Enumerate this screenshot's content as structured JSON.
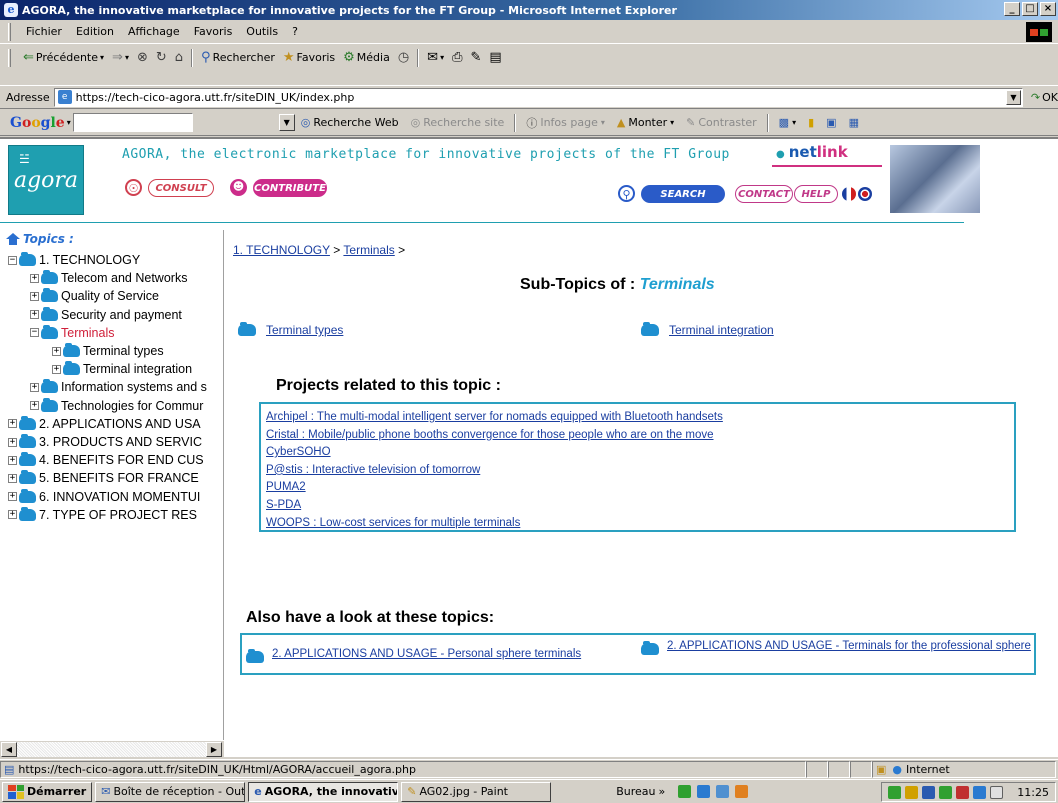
{
  "window": {
    "title": "AGORA, the innovative marketplace for innovative projects for the FT Group - Microsoft Internet Explorer",
    "controls": [
      "_",
      "□",
      "×"
    ]
  },
  "menu": [
    "Fichier",
    "Edition",
    "Affichage",
    "Favoris",
    "Outils",
    "?"
  ],
  "toolbar": {
    "back": "Précédente",
    "search": "Rechercher",
    "favorites": "Favoris",
    "media": "Média"
  },
  "address": {
    "label": "Adresse",
    "url": "https://tech-cico-agora.utt.fr/siteDIN_UK/index.php",
    "go": "OK"
  },
  "google_bar": {
    "logo": [
      "G",
      "o",
      "o",
      "g",
      "l",
      "e"
    ],
    "web_search": "Recherche Web",
    "site_search": "Recherche site",
    "page_info": "Infos page",
    "up": "Monter",
    "contrast": "Contraster"
  },
  "banner": {
    "logo_text": "agora",
    "tagline": "AGORA, the electronic marketplace for innovative projects of the FT Group",
    "consult": "CONSULT",
    "contribute": "CONTRIBUTE",
    "search": "SEARCH",
    "contact": "CONTACT",
    "help": "HELP",
    "netlink_net": "net",
    "netlink_link": "link"
  },
  "tree": {
    "title": "Topics :",
    "items": [
      {
        "label": "1. TECHNOLOGY",
        "level": 0,
        "expanded": true
      },
      {
        "label": "Telecom and Networks",
        "level": 1,
        "expanded": false
      },
      {
        "label": "Quality of Service",
        "level": 1,
        "expanded": false
      },
      {
        "label": "Security and payment",
        "level": 1,
        "expanded": false
      },
      {
        "label": "Terminals",
        "level": 1,
        "expanded": true,
        "active": true
      },
      {
        "label": "Terminal types",
        "level": 2,
        "expanded": false
      },
      {
        "label": "Terminal integration",
        "level": 2,
        "expanded": false
      },
      {
        "label": "Information systems and s",
        "level": 1,
        "expanded": false
      },
      {
        "label": "Technologies for Commur",
        "level": 1,
        "expanded": false
      },
      {
        "label": "2. APPLICATIONS AND USA",
        "level": 0,
        "expanded": false
      },
      {
        "label": "3. PRODUCTS AND SERVIC",
        "level": 0,
        "expanded": false
      },
      {
        "label": "4. BENEFITS FOR END CUS",
        "level": 0,
        "expanded": false
      },
      {
        "label": "5. BENEFITS FOR FRANCE",
        "level": 0,
        "expanded": false
      },
      {
        "label": "6. INNOVATION MOMENTUI",
        "level": 0,
        "expanded": false
      },
      {
        "label": "7. TYPE OF PROJECT RES",
        "level": 0,
        "expanded": false
      }
    ]
  },
  "breadcrumb": {
    "part1": "1. TECHNOLOGY",
    "sep": ">",
    "part2": "Terminals"
  },
  "main": {
    "subtopics_label": "Sub-Topics of : ",
    "subtopics_topic": "Terminals",
    "subtopics": [
      "Terminal types",
      "Terminal integration"
    ],
    "projects_title": "Projects related to this topic :",
    "projects": [
      "Archipel : The multi-modal intelligent server for nomads equipped with Bluetooth handsets",
      "Cristal : Mobile/public phone booths convergence for those people who are on the move",
      "CyberSOHO",
      "P@stis : Interactive television of tomorrow",
      "PUMA2",
      "S-PDA",
      "WOOPS : Low-cost services for multiple terminals"
    ],
    "related_title": "Also have a look at these topics:",
    "related": [
      "2. APPLICATIONS AND USAGE - Personal sphere terminals",
      "2. APPLICATIONS AND USAGE - Terminals for the professional sphere"
    ]
  },
  "status": {
    "url": "https://tech-cico-agora.utt.fr/siteDIN_UK/Html/AGORA/accueil_agora.php",
    "zone": "Internet"
  },
  "taskbar": {
    "start": "Démarrer",
    "tasks": [
      "Boîte de réception - Outlo...",
      "AGORA, the innovativ...",
      "AG02.jpg - Paint"
    ],
    "desktop": "Bureau",
    "clock": "11:25"
  }
}
